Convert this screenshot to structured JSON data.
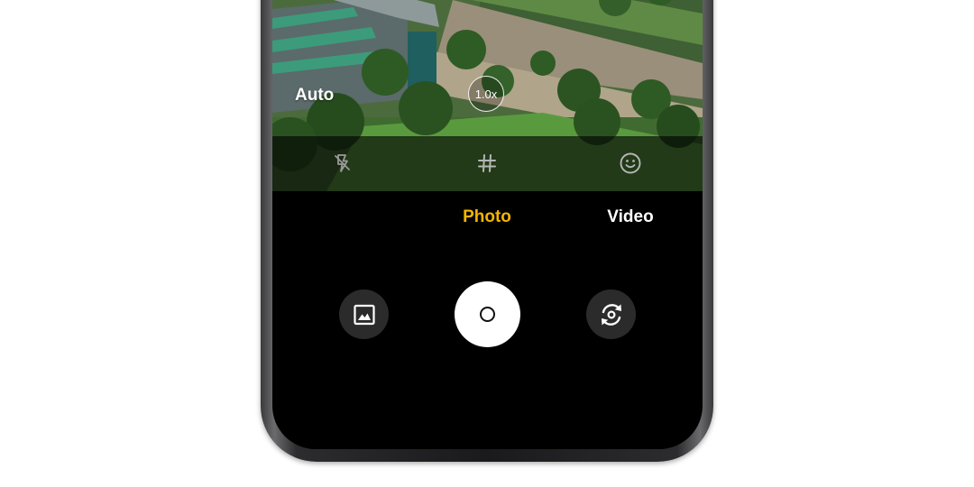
{
  "camera": {
    "mode_label": "Auto",
    "zoom_level": "1.0x"
  },
  "quick_settings": [
    {
      "name": "flash-off",
      "icon": "flash-off-icon"
    },
    {
      "name": "grid",
      "icon": "hash-grid-icon"
    },
    {
      "name": "face-beauty",
      "icon": "smiley-face-icon"
    }
  ],
  "mode_tabs": {
    "items": [
      "Photo",
      "Video"
    ],
    "active": "Photo",
    "active_color": "#f4b400"
  },
  "controls": {
    "gallery_icon": "gallery-image-icon",
    "shutter_icon": "shutter-icon",
    "switch_icon": "switch-camera-icon"
  }
}
